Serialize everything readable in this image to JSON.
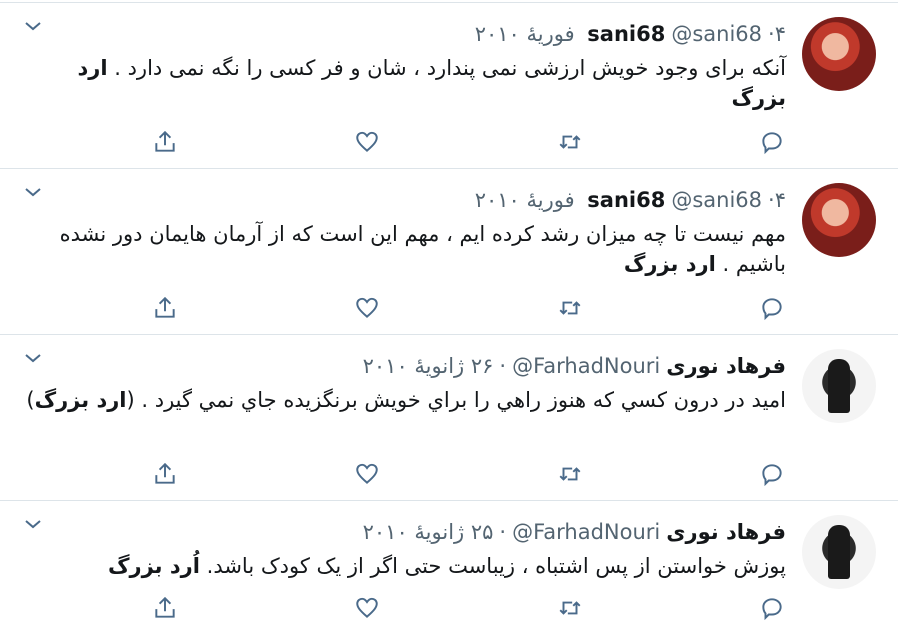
{
  "tweets": [
    {
      "name": "sani68",
      "handle": "@sani68",
      "date": "۴ فوریهٔ ۲۰۱۰",
      "text": "آنکه برای وجود خویش ارزشی نمی پندارد ، شان و فر کسی را نگه نمی دارد .",
      "signature": "ارد بزرگ",
      "avatar": "sani68-avatar"
    },
    {
      "name": "sani68",
      "handle": "@sani68",
      "date": "۴ فوریهٔ ۲۰۱۰",
      "text": "مهم نیست تا چه میزان رشد کرده ایم ، مهم این است که از آرمان هایمان دور نشده باشیم .",
      "signature": "ارد بزرگ",
      "avatar": "sani68-avatar"
    },
    {
      "name": "فرهاد نوری",
      "handle": "@FarhadNouri",
      "date": "۲۶ ژانویهٔ ۲۰۱۰",
      "text": "امید در درون کسي که هنوز راهي را براي خويش برنگزيده جاي نمي گيرد . (",
      "signature": "ارد بزرگ",
      "text_after": ")",
      "avatar": "farhadnouri-avatar"
    },
    {
      "name": "فرهاد نوری",
      "handle": "@FarhadNouri",
      "date": "۲۵ ژانویهٔ ۲۰۱۰",
      "text": "پوزش خواستن از پس اشتباه ، زیباست حتی اگر از یک کودک باشد.",
      "signature": "اُرد بزرگ",
      "avatar": "farhadnouri-avatar"
    }
  ],
  "separator": "·",
  "icons": {
    "reply": "reply-icon",
    "retweet": "retweet-icon",
    "like": "heart-icon",
    "share": "share-icon",
    "menu": "chevron-down-icon"
  },
  "colors": {
    "icon": "#4a6a8a",
    "meta": "#536471",
    "divider": "#dde4e9"
  }
}
